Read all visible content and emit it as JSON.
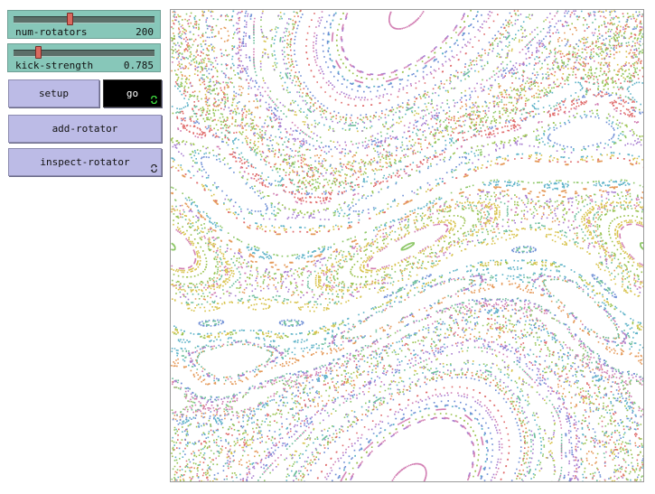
{
  "sliders": [
    {
      "label": "num-rotators",
      "value": "200",
      "fraction": 0.39
    },
    {
      "label": "kick-strength",
      "value": "0.785",
      "fraction": 0.16
    }
  ],
  "buttons": {
    "setup": "setup",
    "go": "go",
    "add_rotator": "add-rotator",
    "inspect_rotator": "inspect-rotator"
  },
  "colors": {
    "palette": [
      "#e06b6b",
      "#e59a5a",
      "#d7c24a",
      "#8fc86a",
      "#6fbf9e",
      "#5fb3c8",
      "#6f8fd6",
      "#a77dd0",
      "#d27fb3",
      "#9ac24d"
    ],
    "slider_bg": "#87c7b9",
    "button_bg": "#bcbbe6"
  },
  "icons": {
    "forever": "forever-loop-icon"
  }
}
